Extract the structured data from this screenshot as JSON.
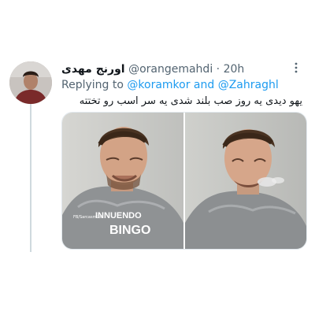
{
  "tweet": {
    "display_name": "اورنج مهدی",
    "handle": "@orangemahdi",
    "separator": "·",
    "time": "20h",
    "reply": {
      "prefix": "Replying to ",
      "user1": "@koramkor",
      "joiner": " and ",
      "user2": "@Zahraghl"
    },
    "text": "یهو دیدی یه روز صب بلند شدی یه سر اسب رو تختته"
  },
  "media": {
    "shirt_text_line1": "INNUENDO",
    "shirt_text_line2": "BINGO",
    "watermark": "FB/SarcasmLol"
  },
  "icons": {
    "more": "more-options-icon"
  },
  "colors": {
    "link": "#1d9bf0",
    "muted": "#536471",
    "text": "#0f1419",
    "thread_line": "#cfd9de"
  }
}
